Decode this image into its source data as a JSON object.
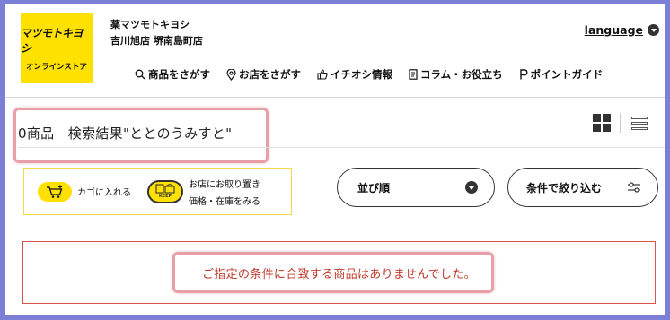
{
  "header": {
    "logo": {
      "main": "マツモトキヨシ",
      "sub": "オンラインストア"
    },
    "store_brand": "薬マツモトキヨシ",
    "store_name": "吉川旭店 堺南島町店",
    "language_label": "language"
  },
  "nav": {
    "items": [
      {
        "label": "商品をさがす",
        "icon": "search-icon"
      },
      {
        "label": "お店をさがす",
        "icon": "map-pin-icon"
      },
      {
        "label": "イチオシ情報",
        "icon": "thumbs-up-icon"
      },
      {
        "label": "コラム・お役立ち",
        "icon": "document-icon"
      },
      {
        "label": "ポイントガイド",
        "icon": "point-icon"
      }
    ]
  },
  "results": {
    "title": "0商品　検索結果\"ととのうみすと\""
  },
  "legend": {
    "cart_label": "カゴに入れる",
    "keep_icon_text": "KEEP",
    "keep_line1": "お店にお取り置き",
    "keep_line2": "価格・在庫をみる"
  },
  "controls": {
    "sort_label": "並び順",
    "filter_label": "条件で絞り込む"
  },
  "notice": {
    "message": "ご指定の条件に合致する商品はありませんでした。"
  },
  "colors": {
    "brand_yellow": "#ffe100",
    "notice_red": "#c0392b",
    "highlight_pink": "#e8a0a8",
    "outer_background": "#7b7fd6"
  }
}
